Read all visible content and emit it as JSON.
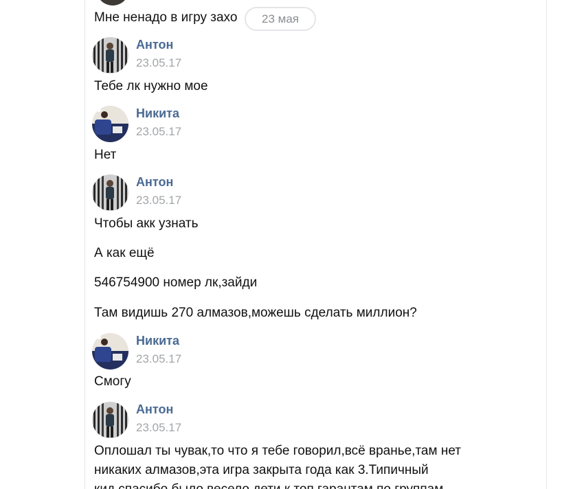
{
  "top": {
    "partial_message": "Мне ненадо в игру захо",
    "date_pill": "23 мая"
  },
  "messages": [
    {
      "author": "Антон",
      "time": "23.05.17",
      "avatar": "anton-avatar",
      "lines": [
        "Тебе лк нужно мое"
      ]
    },
    {
      "author": "Никита",
      "time": "23.05.17",
      "avatar": "nikita-avatar",
      "lines": [
        "Нет"
      ]
    },
    {
      "author": "Антон",
      "time": "23.05.17",
      "avatar": "anton-avatar",
      "lines": [
        "Чтобы акк узнать",
        "А как ещё",
        "546754900 номер лк,зайди",
        "Там видишь 270 алмазов,можешь сделать миллион?"
      ]
    },
    {
      "author": "Никита",
      "time": "23.05.17",
      "avatar": "nikita-avatar",
      "lines": [
        "Смогу"
      ]
    },
    {
      "author": "Антон",
      "time": "23.05.17",
      "avatar": "anton-avatar",
      "lines": [
        "Оплошал ты чувак,то что я тебе говорил,всё вранье,там нет\nникаких алмазов,эта игра закрыта года как 3.Типичный\nкид,спасибо было весело дети к топ гарантам по группам"
      ]
    }
  ],
  "colors": {
    "author": "#4a6a94",
    "timestamp": "#a2a5a8",
    "text": "#111111",
    "pill_border": "#e3e5e8"
  }
}
